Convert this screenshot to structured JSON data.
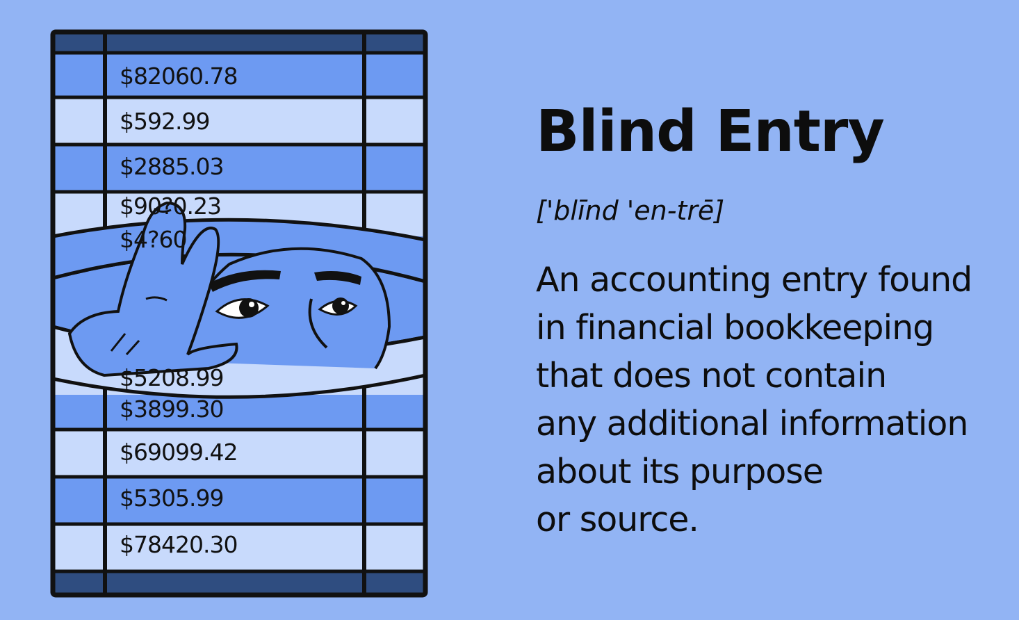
{
  "term": {
    "title": "Blind Entry",
    "pronunciation": "['blīnd 'en-trē]",
    "definition_lines": [
      "An accounting entry found",
      "in financial bookkeeping",
      "that does not contain",
      "any additional information",
      "about its purpose",
      "or source."
    ]
  },
  "ledger": {
    "amounts": [
      "$82060.78",
      "$592.99",
      "$2885.03",
      "$90?0.23",
      "$4?60",
      "$5208.99",
      "$3899.30",
      "$69099.42",
      "$5305.99",
      "$78420.30"
    ]
  },
  "colors": {
    "background": "#92b4f4",
    "dark_band": "#2f4d80",
    "row_mid": "#6d9af2",
    "row_light": "#c8dafc",
    "skin": "#6d9af2",
    "outline": "#111111"
  }
}
